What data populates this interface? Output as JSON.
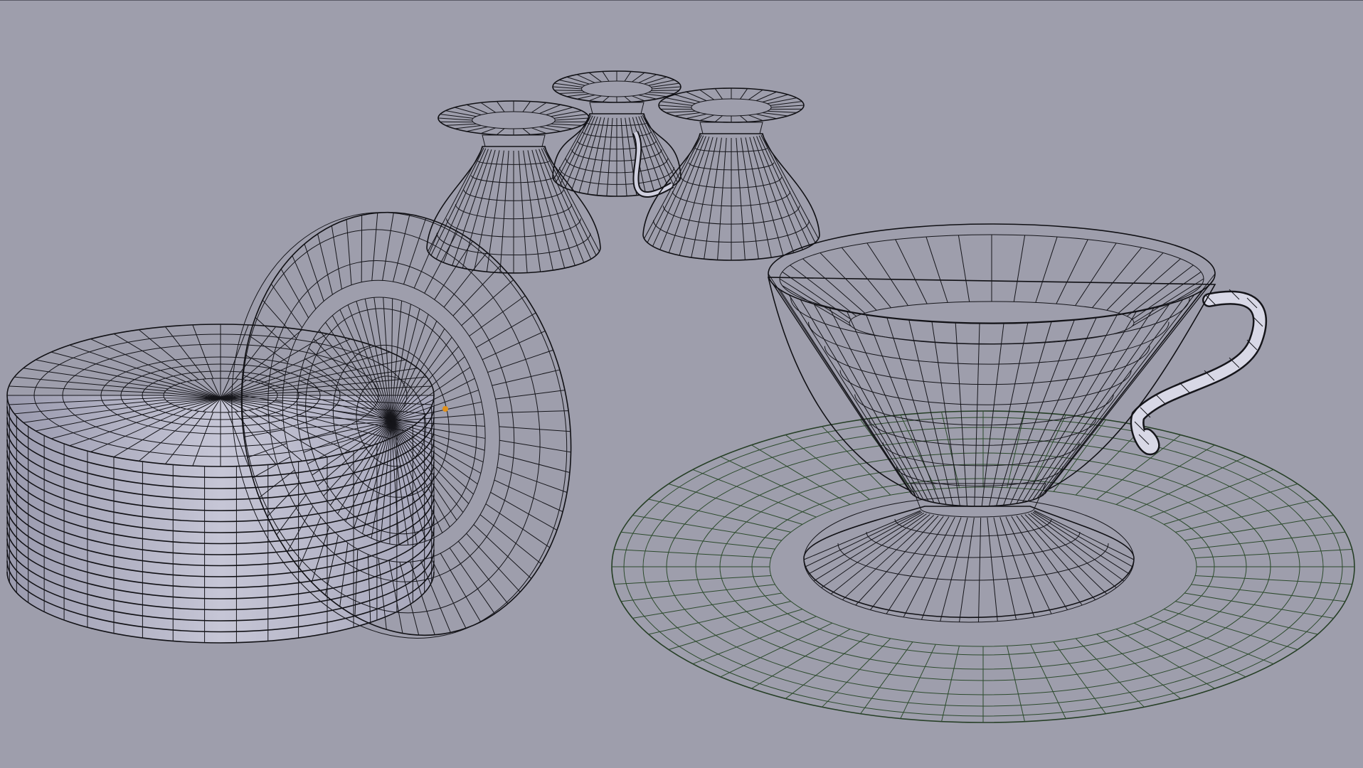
{
  "viewport": {
    "background_color": "#9e9eac",
    "mesh_fill_light": "#e6e6f2",
    "mesh_fill_mid": "#c2c2d4",
    "mesh_fill_dark": "#8a8aa0",
    "wire_color": "#15151a",
    "selected_wire_color": "#2c4a2c",
    "origin_marker_color": "#e0901a"
  },
  "objects": [
    {
      "name": "plate-stack-icon",
      "selected": false
    },
    {
      "name": "leaning-saucer-icon",
      "selected": false
    },
    {
      "name": "inverted-cup-icon",
      "selected": false
    },
    {
      "name": "inverted-cup-icon",
      "selected": false
    },
    {
      "name": "inverted-cup-icon",
      "selected": false
    },
    {
      "name": "saucer-icon",
      "selected": true
    },
    {
      "name": "teacup-icon",
      "selected": false
    }
  ]
}
